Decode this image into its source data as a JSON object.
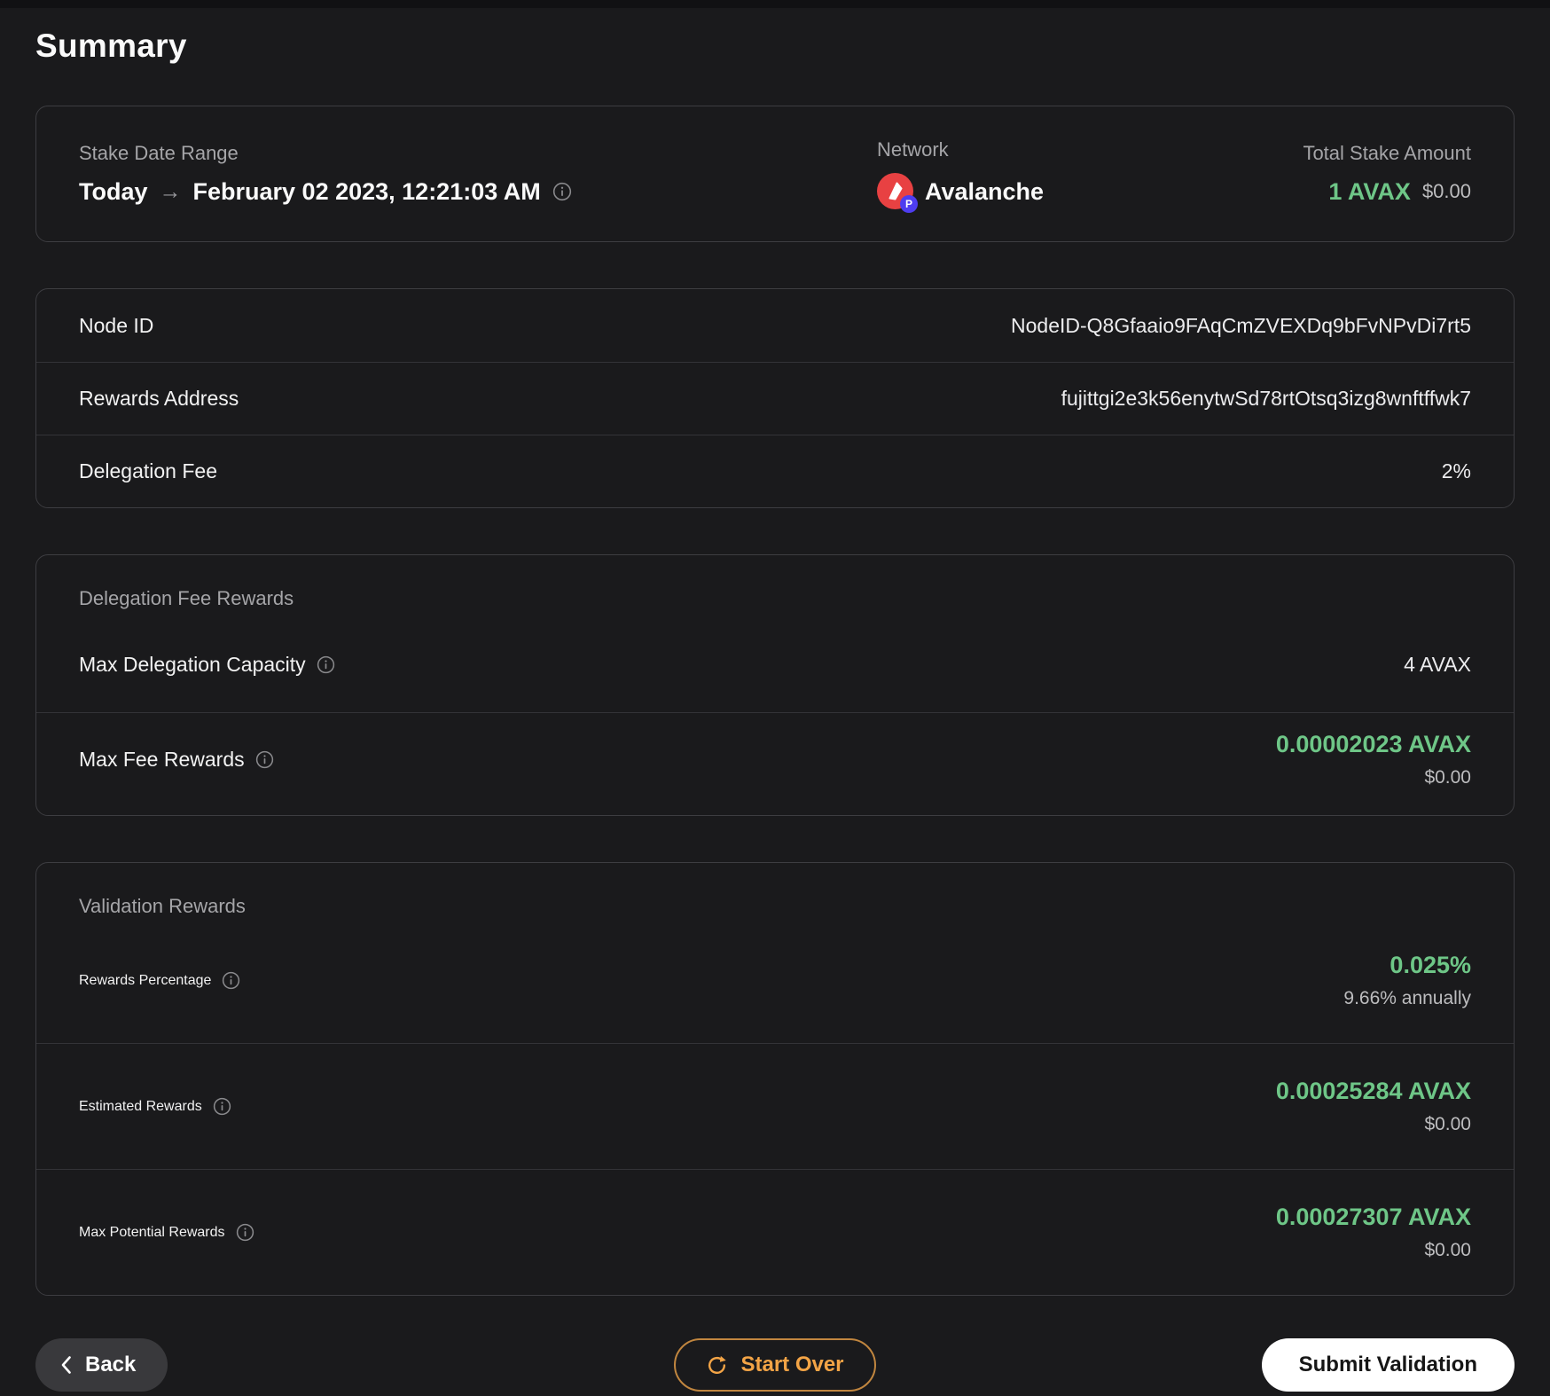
{
  "page": {
    "title": "Summary"
  },
  "colors": {
    "background": "#1a1a1c",
    "card_border": "#3d3d41",
    "green_accent": "#6ec687",
    "orange_accent": "#f3a446",
    "avalanche_red": "#e84142",
    "badge_purple": "#4e3df0"
  },
  "icons": {
    "date_info": "info-icon",
    "network_logo": "avalanche-logo",
    "p_chain_badge": "P",
    "back": "chevron-left-icon",
    "start_over": "refresh-icon"
  },
  "overview": {
    "stake_date_range": {
      "label": "Stake Date Range",
      "from": "Today",
      "arrow": "→",
      "to": "February 02 2023, 12:21:03 AM"
    },
    "network": {
      "label": "Network",
      "value": "Avalanche",
      "badge": "P"
    },
    "total_stake": {
      "label": "Total Stake Amount",
      "amount": "1 AVAX",
      "usd": "$0.00"
    }
  },
  "details_card": {
    "rows": [
      {
        "label": "Node ID",
        "value": "NodeID-Q8Gfaaio9FAqCmZVEXDq9bFvNPvDi7rt5"
      },
      {
        "label": "Rewards Address",
        "value": "fujittgi2e3k56enytwSd78rtOtsq3izg8wnftffwk7"
      },
      {
        "label": "Delegation Fee",
        "value": "2%"
      }
    ]
  },
  "delegation_card": {
    "title": "Delegation Fee Rewards",
    "rows": [
      {
        "label": "Max Delegation Capacity",
        "value": "4 AVAX"
      },
      {
        "label": "Max Fee Rewards",
        "value": "0.00002023 AVAX",
        "usd": "$0.00"
      }
    ]
  },
  "validation_card": {
    "title": "Validation Rewards",
    "rows": [
      {
        "label": "Rewards Percentage",
        "value": "0.025%",
        "sub": "9.66% annually"
      },
      {
        "label": "Estimated Rewards",
        "value": "0.00025284 AVAX",
        "sub": "$0.00"
      },
      {
        "label": "Max Potential Rewards",
        "value": "0.00027307 AVAX",
        "sub": "$0.00"
      }
    ]
  },
  "footer": {
    "back_label": "Back",
    "start_over_label": "Start Over",
    "submit_label": "Submit Validation"
  }
}
